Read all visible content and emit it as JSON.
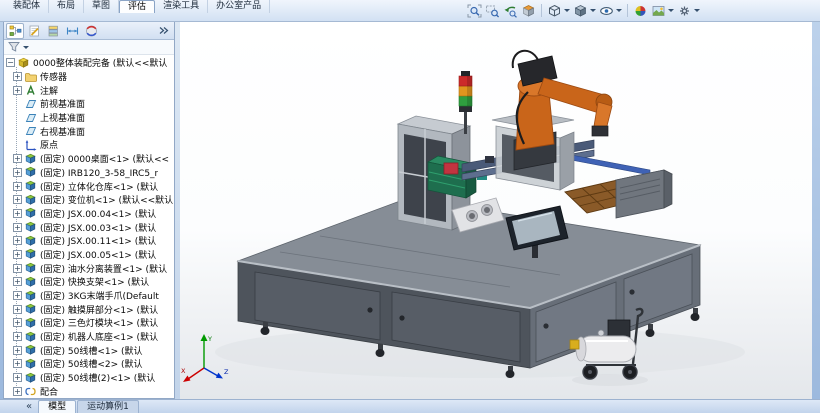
{
  "colors": {
    "window_border": "#9bb8dd",
    "ribbon_bg": "#d2e1f3",
    "active_tab_bg": "#fdfeff",
    "panel_bg": "#ffffff",
    "machine_gray": "#4e545c",
    "robot_orange": "#c9651a",
    "signal_red": "#cc2a2a",
    "signal_yellow": "#e0951e",
    "signal_green": "#2f9e3f",
    "triad_x": "#cc0000",
    "triad_y": "#009a00",
    "triad_z": "#0033cc"
  },
  "ribbon": {
    "tabs": [
      {
        "label": "装配体",
        "state": ""
      },
      {
        "label": "布局",
        "state": ""
      },
      {
        "label": "草图",
        "state": ""
      },
      {
        "label": "评估",
        "state": "active"
      },
      {
        "label": "渲染工具",
        "state": ""
      },
      {
        "label": "办公室产品",
        "state": ""
      }
    ]
  },
  "headsup": {
    "icons": [
      {
        "name": "zoom-fit-icon"
      },
      {
        "name": "zoom-area-icon"
      },
      {
        "name": "previous-view-icon"
      },
      {
        "name": "section-view-icon"
      },
      {
        "name": "view-orientation-icon",
        "dropdown": true
      },
      {
        "name": "display-style-icon",
        "dropdown": true
      },
      {
        "name": "hide-show-items-icon",
        "dropdown": true
      },
      {
        "name": "edit-appearance-icon"
      },
      {
        "name": "apply-scene-icon",
        "dropdown": true
      },
      {
        "name": "view-settings-icon",
        "dropdown": true
      }
    ]
  },
  "panel": {
    "tab_icons": [
      "featuremanager-tree-icon",
      "propertymanager-icon",
      "configurationmanager-icon",
      "dimxpertmanager-icon",
      "displaymanager-icon",
      "panel-tabs-overflow-icon"
    ]
  },
  "tree": {
    "root": {
      "label": "0000整体装配完备 (默认<<默认",
      "icon": "t-assembly",
      "exp": "e-minus"
    },
    "items": [
      {
        "label": "传感器",
        "icon": "t-folder",
        "exp": "e-plus"
      },
      {
        "label": "注解",
        "icon": "t-annotation",
        "exp": "e-plus"
      },
      {
        "label": "前视基准面",
        "icon": "t-plane",
        "exp": "e-none"
      },
      {
        "label": "上视基准面",
        "icon": "t-plane",
        "exp": "e-none"
      },
      {
        "label": "右视基准面",
        "icon": "t-plane",
        "exp": "e-none"
      },
      {
        "label": "原点",
        "icon": "t-origin",
        "exp": "e-none"
      },
      {
        "label": "(固定) 0000桌面<1> (默认<<",
        "icon": "t-component",
        "exp": "e-plus"
      },
      {
        "label": "(固定) IRB120_3-58_IRC5_r",
        "icon": "t-component",
        "exp": "e-plus"
      },
      {
        "label": "(固定) 立体化仓库<1> (默认",
        "icon": "t-component",
        "exp": "e-plus"
      },
      {
        "label": "(固定) 变位机<1> (默认<<默认",
        "icon": "t-component",
        "exp": "e-plus"
      },
      {
        "label": "(固定) JSX.00.04<1> (默认",
        "icon": "t-component",
        "exp": "e-plus"
      },
      {
        "label": "(固定) JSX.00.03<1> (默认",
        "icon": "t-component",
        "exp": "e-plus"
      },
      {
        "label": "(固定) JSX.00.11<1> (默认",
        "icon": "t-component",
        "exp": "e-plus"
      },
      {
        "label": "(固定) JSX.00.05<1> (默认",
        "icon": "t-component",
        "exp": "e-plus"
      },
      {
        "label": "(固定) 油水分离装置<1> (默认",
        "icon": "t-component",
        "exp": "e-plus"
      },
      {
        "label": "(固定) 快换支架<1> (默认",
        "icon": "t-component",
        "exp": "e-plus"
      },
      {
        "label": "(固定) 3KG末端手爪(Default",
        "icon": "t-component",
        "exp": "e-plus"
      },
      {
        "label": "(固定) 触摸屏部分<1> (默认",
        "icon": "t-component",
        "exp": "e-plus"
      },
      {
        "label": "(固定) 三色灯模块<1> (默认",
        "icon": "t-component",
        "exp": "e-plus"
      },
      {
        "label": "(固定) 机器人底座<1> (默认",
        "icon": "t-component",
        "exp": "e-plus"
      },
      {
        "label": "(固定) 50线槽<1> (默认",
        "icon": "t-component",
        "exp": "e-plus"
      },
      {
        "label": "(固定) 50线槽<2> (默认",
        "icon": "t-component",
        "exp": "e-plus"
      },
      {
        "label": "(固定) 50线槽(2)<1> (默认",
        "icon": "t-component",
        "exp": "e-plus"
      },
      {
        "label": "配合",
        "icon": "t-mates",
        "exp": "e-plus"
      }
    ]
  },
  "statusbar": {
    "collapse_label": "«",
    "tabs": [
      {
        "label": "模型",
        "state": "active"
      },
      {
        "label": "运动算例1",
        "state": ""
      }
    ]
  },
  "viewport": {
    "triad": {
      "x": "X",
      "y": "Y",
      "z": "Z"
    }
  }
}
